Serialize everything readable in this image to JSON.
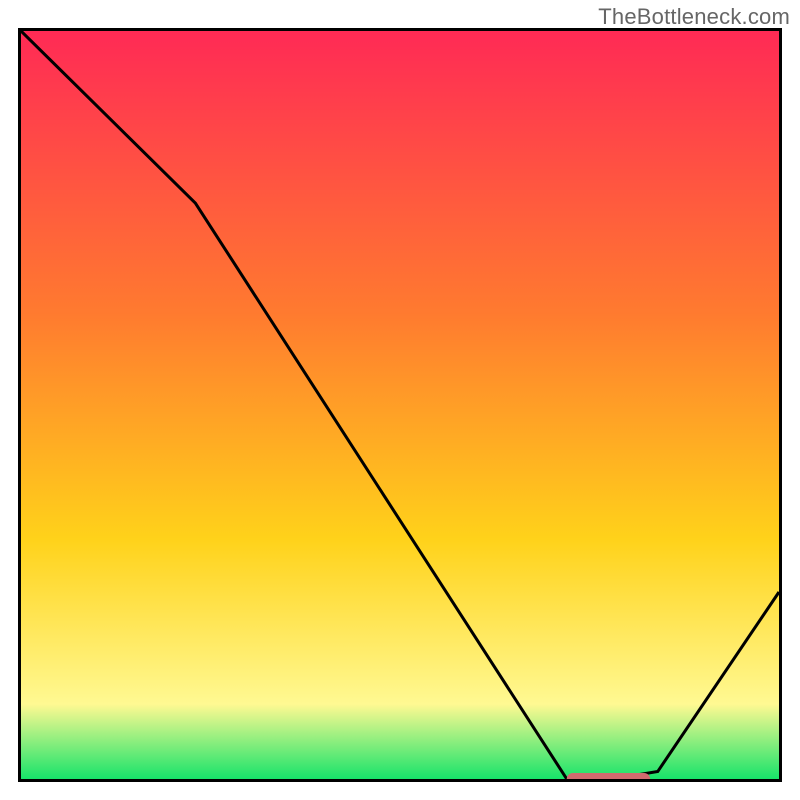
{
  "watermark": "TheBottleneck.com",
  "colors": {
    "top": "#ff2a55",
    "mid1": "#ff7b2f",
    "mid2": "#ffd21a",
    "mid3": "#fff992",
    "bottom": "#17e36a",
    "line": "#000000",
    "marker": "#d06a6e",
    "border": "#000000",
    "watermark": "#666666"
  },
  "chart_data": {
    "type": "line",
    "title": "",
    "xlabel": "",
    "ylabel": "",
    "xlim": [
      0,
      100
    ],
    "ylim": [
      0,
      100
    ],
    "grid": false,
    "series": [
      {
        "name": "bottleneck-curve",
        "x": [
          0,
          23,
          72,
          78,
          84,
          100
        ],
        "y": [
          100,
          77,
          0,
          0,
          1,
          25
        ]
      }
    ],
    "annotations": [
      {
        "name": "optimal-marker",
        "shape": "rounded-bar",
        "x_start": 72,
        "x_end": 83,
        "y": 0,
        "color": "#d06a6e"
      }
    ]
  }
}
